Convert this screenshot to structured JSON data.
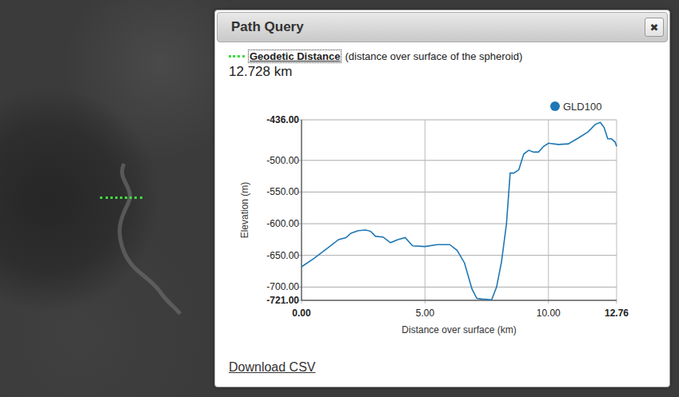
{
  "dialog": {
    "title": "Path Query",
    "close": "✖"
  },
  "measure": {
    "link": "Geodetic Distance",
    "note": "(distance over surface of the spheroid)",
    "value": "12.728 km"
  },
  "chart": {
    "y_axis_label": "Elevation (m)",
    "x_axis_label": "Distance over surface (km)",
    "y_ticks": [
      "-436.00",
      "-500.00",
      "-550.00",
      "-600.00",
      "-650.00",
      "-700.00",
      "-721.00"
    ],
    "x_ticks": [
      "0.00",
      "5.00",
      "10.00",
      "12.76"
    ],
    "series": [
      {
        "name": "GLD100",
        "color": "#1f77b4",
        "distances_km": [
          0,
          0.5,
          1,
          1.5,
          1.8,
          2,
          2.3,
          2.6,
          2.8,
          3.0,
          3.3,
          3.6,
          3.9,
          4.2,
          4.5,
          5.0,
          5.5,
          6.0,
          6.3,
          6.6,
          6.9,
          7.1,
          7.3,
          7.7,
          7.9,
          8.1,
          8.3,
          8.45,
          8.6,
          8.8,
          9.0,
          9.2,
          9.4,
          9.6,
          9.8,
          10.0,
          10.4,
          10.8,
          11.2,
          11.6,
          11.9,
          12.1,
          12.25,
          12.4,
          12.55,
          12.7,
          12.76
        ],
        "values": [
          -668,
          -655,
          -640,
          -625,
          -622,
          -615,
          -611,
          -610,
          -612,
          -620,
          -621,
          -630,
          -625,
          -622,
          -635,
          -636,
          -633,
          -633,
          -642,
          -662,
          -703,
          -718,
          -719,
          -720,
          -700,
          -660,
          -600,
          -520,
          -520,
          -515,
          -490,
          -484,
          -487,
          -487,
          -478,
          -473,
          -475,
          -474,
          -465,
          -455,
          -443,
          -440,
          -448,
          -466,
          -466,
          -471,
          -478
        ]
      }
    ]
  },
  "download": "Download CSV"
}
